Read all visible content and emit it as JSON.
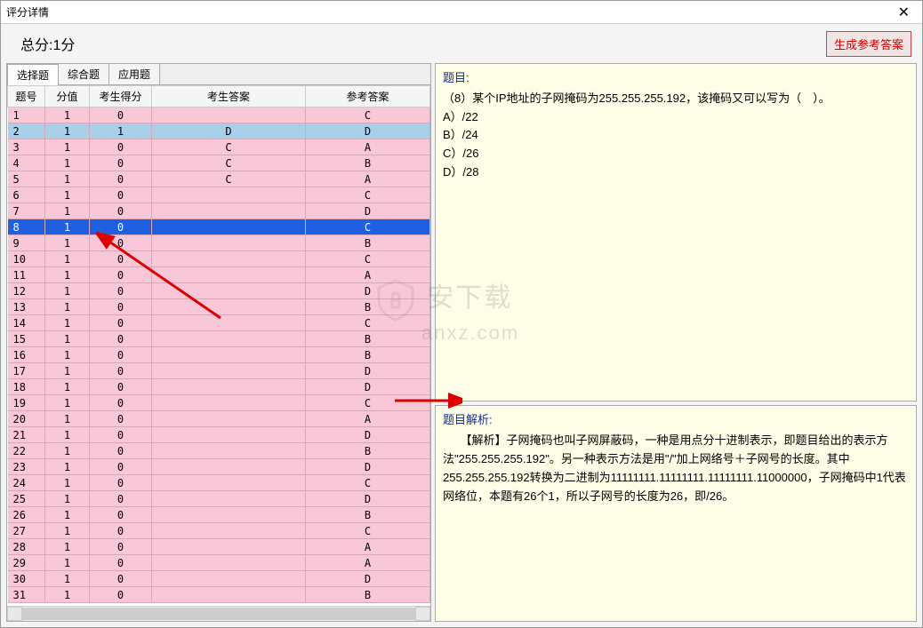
{
  "window": {
    "title": "评分详情"
  },
  "header": {
    "total_label": "总分:1分",
    "gen_answer_btn": "生成参考答案"
  },
  "tabs": [
    {
      "label": "选择题",
      "active": true
    },
    {
      "label": "综合题",
      "active": false
    },
    {
      "label": "应用题",
      "active": false
    }
  ],
  "table": {
    "headers": {
      "num": "题号",
      "value": "分值",
      "score": "考生得分",
      "student_answer": "考生答案",
      "ref_answer": "参考答案"
    },
    "rows": [
      {
        "n": "1",
        "v": "1",
        "s": "0",
        "sa": "",
        "ra": "C",
        "cls": "pink"
      },
      {
        "n": "2",
        "v": "1",
        "s": "1",
        "sa": "D",
        "ra": "D",
        "cls": "blue"
      },
      {
        "n": "3",
        "v": "1",
        "s": "0",
        "sa": "C",
        "ra": "A",
        "cls": "pink"
      },
      {
        "n": "4",
        "v": "1",
        "s": "0",
        "sa": "C",
        "ra": "B",
        "cls": "pink"
      },
      {
        "n": "5",
        "v": "1",
        "s": "0",
        "sa": "C",
        "ra": "A",
        "cls": "pink"
      },
      {
        "n": "6",
        "v": "1",
        "s": "0",
        "sa": "",
        "ra": "C",
        "cls": "pink"
      },
      {
        "n": "7",
        "v": "1",
        "s": "0",
        "sa": "",
        "ra": "D",
        "cls": "pink"
      },
      {
        "n": "8",
        "v": "1",
        "s": "0",
        "sa": "",
        "ra": "C",
        "cls": "sel"
      },
      {
        "n": "9",
        "v": "1",
        "s": "0",
        "sa": "",
        "ra": "B",
        "cls": "pink"
      },
      {
        "n": "10",
        "v": "1",
        "s": "0",
        "sa": "",
        "ra": "C",
        "cls": "pink"
      },
      {
        "n": "11",
        "v": "1",
        "s": "0",
        "sa": "",
        "ra": "A",
        "cls": "pink"
      },
      {
        "n": "12",
        "v": "1",
        "s": "0",
        "sa": "",
        "ra": "D",
        "cls": "pink"
      },
      {
        "n": "13",
        "v": "1",
        "s": "0",
        "sa": "",
        "ra": "B",
        "cls": "pink"
      },
      {
        "n": "14",
        "v": "1",
        "s": "0",
        "sa": "",
        "ra": "C",
        "cls": "pink"
      },
      {
        "n": "15",
        "v": "1",
        "s": "0",
        "sa": "",
        "ra": "B",
        "cls": "pink"
      },
      {
        "n": "16",
        "v": "1",
        "s": "0",
        "sa": "",
        "ra": "B",
        "cls": "pink"
      },
      {
        "n": "17",
        "v": "1",
        "s": "0",
        "sa": "",
        "ra": "D",
        "cls": "pink"
      },
      {
        "n": "18",
        "v": "1",
        "s": "0",
        "sa": "",
        "ra": "D",
        "cls": "pink"
      },
      {
        "n": "19",
        "v": "1",
        "s": "0",
        "sa": "",
        "ra": "C",
        "cls": "pink"
      },
      {
        "n": "20",
        "v": "1",
        "s": "0",
        "sa": "",
        "ra": "A",
        "cls": "pink"
      },
      {
        "n": "21",
        "v": "1",
        "s": "0",
        "sa": "",
        "ra": "D",
        "cls": "pink"
      },
      {
        "n": "22",
        "v": "1",
        "s": "0",
        "sa": "",
        "ra": "B",
        "cls": "pink"
      },
      {
        "n": "23",
        "v": "1",
        "s": "0",
        "sa": "",
        "ra": "D",
        "cls": "pink"
      },
      {
        "n": "24",
        "v": "1",
        "s": "0",
        "sa": "",
        "ra": "C",
        "cls": "pink"
      },
      {
        "n": "25",
        "v": "1",
        "s": "0",
        "sa": "",
        "ra": "D",
        "cls": "pink"
      },
      {
        "n": "26",
        "v": "1",
        "s": "0",
        "sa": "",
        "ra": "B",
        "cls": "pink"
      },
      {
        "n": "27",
        "v": "1",
        "s": "0",
        "sa": "",
        "ra": "C",
        "cls": "pink"
      },
      {
        "n": "28",
        "v": "1",
        "s": "0",
        "sa": "",
        "ra": "A",
        "cls": "pink"
      },
      {
        "n": "29",
        "v": "1",
        "s": "0",
        "sa": "",
        "ra": "A",
        "cls": "pink"
      },
      {
        "n": "30",
        "v": "1",
        "s": "0",
        "sa": "",
        "ra": "D",
        "cls": "pink"
      },
      {
        "n": "31",
        "v": "1",
        "s": "0",
        "sa": "",
        "ra": "B",
        "cls": "pink"
      }
    ]
  },
  "question": {
    "label": "题目:",
    "stem": "（8）某个IP地址的子网掩码为255.255.255.192，该掩码又可以写为（　）。",
    "options": {
      "A": "A）/22",
      "B": "B）/24",
      "C": "C）/26",
      "D": "D）/28"
    }
  },
  "analysis": {
    "label": "题目解析:",
    "body": "　　【解析】子网掩码也叫子网屏蔽码，一种是用点分十进制表示，即题目给出的表示方法\"255.255.255.192\"。另一种表示方法是用\"/\"加上网络号＋子网号的长度。其中255.255.255.192转换为二进制为11111111.11111111.11111111.11000000，子网掩码中1代表网络位，本题有26个1，所以子网号的长度为26，即/26。"
  },
  "watermark": {
    "line1": "安下载",
    "line2": "anxz.com"
  }
}
